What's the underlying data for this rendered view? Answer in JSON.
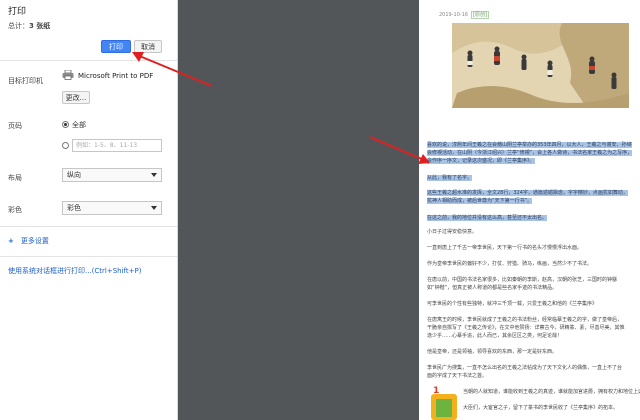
{
  "panel": {
    "title": "打印",
    "total_label": "总计：",
    "total_value": "3 张纸",
    "print_button": "打印",
    "cancel_button": "取消",
    "destination_label": "目标打印机",
    "printer_name": "Microsoft Print to PDF",
    "change_button": "更改...",
    "pages_label": "页码",
    "pages_all": "全部",
    "pages_custom_placeholder": "例如：1-5、8、11-13",
    "layout_label": "布局",
    "layout_value": "纵向",
    "color_label": "彩色",
    "color_value": "彩色",
    "more_settings": "更多设置",
    "system_dialog_link": "使用系统对话框进行打印...(Ctrl+Shift+P)",
    "accent_color": "#4285f4",
    "link_color": "#1a5fcc",
    "icons": [
      "printer-icon",
      "plus-icon",
      "chevron-down-icon",
      "radio-icon"
    ]
  },
  "preview": {
    "date": "2019-10-16",
    "tag": "[原创]",
    "background_color": "#525659",
    "highlight_color": "#a9c3e4",
    "annotation_color": "#e02020",
    "highlighted_paragraphs": [
      "喜欢的说，淳熙年间王羲之在会稽山阴兰亭举办的353年四月，以大人，王羲之与谢安、孙绰等四十一",
      "会修禊活动，在山阴（今浙江绍兴）兰亭“修禊”，会上各人做诗，书法名家王羲之为之写序，",
      "会作序一序文，记录这次盛况，即《兰亭集序》。",
      "从此，我有了名字。",
      "这些王羲之超水准的发挥，全文28行，324字，通篇遒媚飘逸，字字精妙，点画犹如舞动，",
      "犹神人相助而成，被后世尊为“天下第一行书”。",
      "在这之前，我的地位并没有这么高，甚至还不太出名。"
    ],
    "paragraphs": [
      "小日子过得安稳快意。",
      "一直到唐上了千古一帝李世民，天下第一行书的名头才慢慢浮出水面。",
      "作为皇帝李世民的偏好不少，打仗、狩猎、骑马，练画，当然少不了书法。",
      "在唐以前，中国的书法名家很多，比如秦朝的李斯，赵高，汉朝的张芝，三国时的钟繇",
      "如“钟楷”，但真正被人称道的都是些名家手迹的书法精品。",
      "可李世民的个性有些独特，就冲三千顶一载，只爱王羲之和他的《兰亭集序》",
      "在唐寓王的时候，李世民就成了王羲之的书法粉丝，经常临摹王羲之的字，做了皇帝后，",
      "干脆亲自撰写了《王羲之传论》，在文中他赞扬：详察古今，研精篆、素，尽善尽美，其惟",
      "逸少乎……心摹手追，此人而已，其余区区之类，何足论哉！",
      "他是皇帝，还是领袖，领导喜欢的东西，那一定是好东西。",
      "李世民广为搜集，一直不怎么出名的王羲之法帖成为了天下文化人的偶像，一直上不了台",
      "面的字成了天下书法之首。",
      "当朝的人就知道，谁能收到王羲之的真迹，谁就能加官进爵，拥有权力和地位上这样的待遇。",
      "大臣们，大宦官之子，留下了篆书的李世民收了《兰亭集序》的拓本。"
    ]
  }
}
